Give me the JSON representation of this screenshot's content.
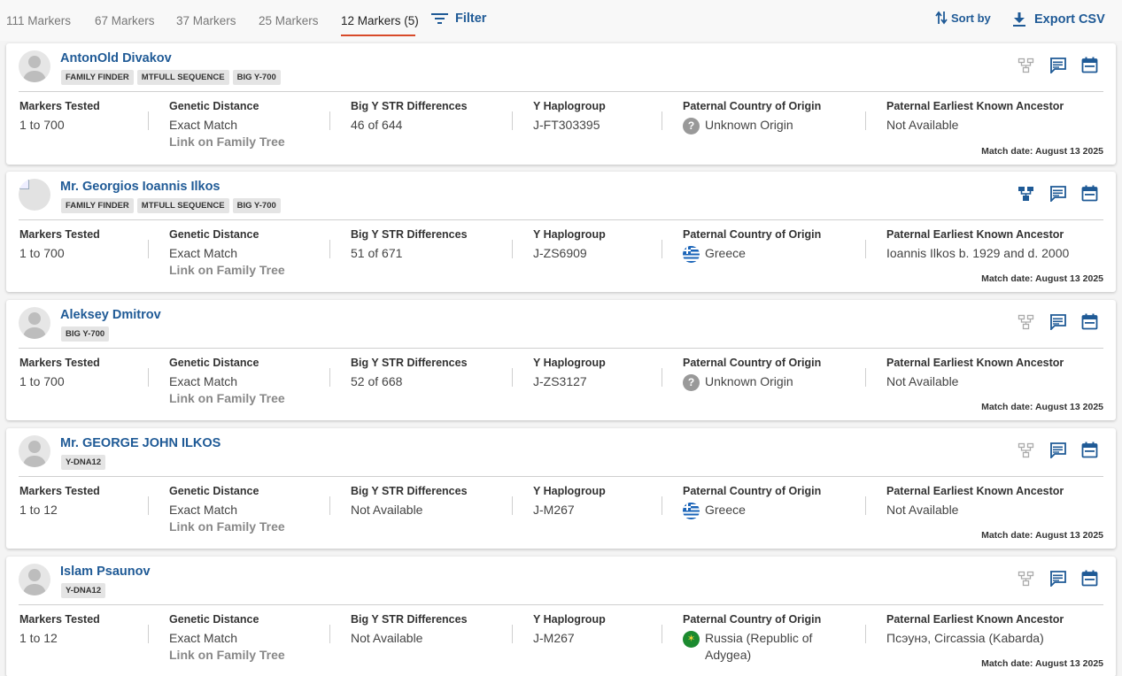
{
  "tabs": [
    {
      "label": "111 Markers"
    },
    {
      "label": "67 Markers"
    },
    {
      "label": "37 Markers"
    },
    {
      "label": "25 Markers"
    },
    {
      "label": "12 Markers (5)",
      "active": true
    }
  ],
  "toolbar": {
    "filter_label": "Filter",
    "sort_label": "Sort by",
    "export_label": "Export CSV"
  },
  "colors": {
    "accent": "#1f5a96",
    "active_tab": "#d84a2a"
  },
  "headers": {
    "markers_tested": "Markers Tested",
    "genetic_distance": "Genetic Distance",
    "big_y": "Big Y STR Differences",
    "haplogroup": "Y Haplogroup",
    "country": "Paternal Country of Origin",
    "ancestor": "Paternal Earliest Known Ancestor"
  },
  "link_label": "Link on Family Tree",
  "matches": [
    {
      "name": "AntonOld Divakov",
      "badges": [
        "FAMILY FINDER",
        "MTFULL SEQUENCE",
        "BIG Y-700"
      ],
      "markers": "1 to 700",
      "distance": "Exact Match",
      "big_y": "46 of 644",
      "haplogroup": "J-FT303395",
      "country": "Unknown Origin",
      "country_flag": "unknown-flag-icon",
      "country_flag_text": "?",
      "ancestor": "Not Available",
      "match_date": "Match date: August 13 2025",
      "tree_active": false
    },
    {
      "name": "Mr. Georgios Ioannis Ilkos",
      "badges": [
        "FAMILY FINDER",
        "MTFULL SEQUENCE",
        "BIG Y-700"
      ],
      "markers": "1 to 700",
      "distance": "Exact Match",
      "big_y": "51 of 671",
      "haplogroup": "J-ZS6909",
      "country": "Greece",
      "country_flag": "greece-flag-icon",
      "country_flag_text": "",
      "ancestor": "Ioannis Ilkos b. 1929 and d. 2000",
      "match_date": "Match date: August 13 2025",
      "tree_active": true
    },
    {
      "name": "Aleksey Dmitrov",
      "badges": [
        "BIG Y-700"
      ],
      "markers": "1 to 700",
      "distance": "Exact Match",
      "big_y": "52 of 668",
      "haplogroup": "J-ZS3127",
      "country": "Unknown Origin",
      "country_flag": "unknown-flag-icon",
      "country_flag_text": "?",
      "ancestor": "Not Available",
      "match_date": "Match date: August 13 2025",
      "tree_active": false
    },
    {
      "name": "Mr. GEORGE JOHN ILKOS",
      "badges": [
        "Y-DNA12"
      ],
      "markers": "1 to 12",
      "distance": "Exact Match",
      "big_y": "Not Available",
      "haplogroup": "J-M267",
      "country": "Greece",
      "country_flag": "greece-flag-icon",
      "country_flag_text": "",
      "ancestor": "Not Available",
      "match_date": "Match date: August 13 2025",
      "tree_active": false
    },
    {
      "name": "Islam Psaunov",
      "badges": [
        "Y-DNA12"
      ],
      "markers": "1 to 12",
      "distance": "Exact Match",
      "big_y": "Not Available",
      "haplogroup": "J-M267",
      "country": "Russia (Republic of Adygea)",
      "country_flag": "russia-adygea-flag-icon",
      "country_flag_text": "",
      "ancestor": "Псэунэ, Circassia (Kabarda)",
      "match_date": "Match date: August 13 2025",
      "tree_active": false
    }
  ]
}
